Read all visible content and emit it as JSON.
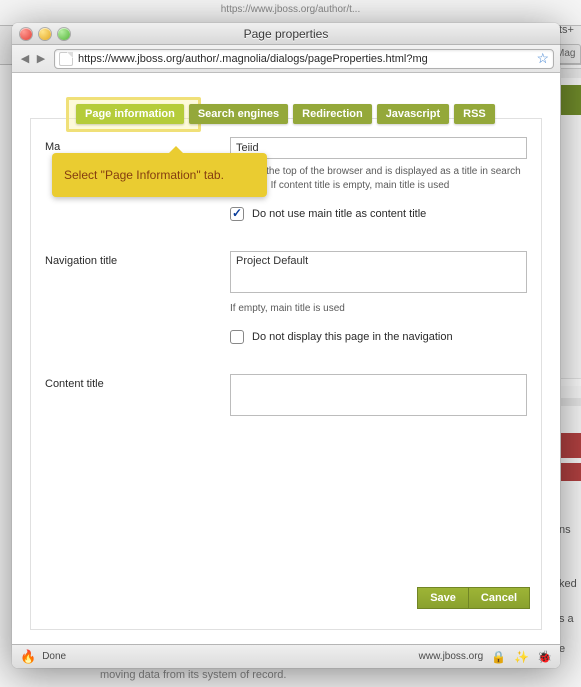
{
  "bg": {
    "top_url": "https://www.jboss.org/author/t...",
    "tab_label": "Mag",
    "bottom_text": "moving data from its system of record.",
    "side_ts": "ts+",
    "side_ns": "ns",
    "side_ked": "ked",
    "side_sa": "s a",
    "side_e": "e"
  },
  "window": {
    "title": "Page properties",
    "url": "https://www.jboss.org/author/.magnolia/dialogs/pageProperties.html?mg"
  },
  "tabs": {
    "page_information": "Page information",
    "search_engines": "Search engines",
    "redirection": "Redirection",
    "javascript": "Javascript",
    "rss": "RSS"
  },
  "callout": {
    "text": "Select \"Page Information\" tab."
  },
  "form": {
    "main_title_label": "Ma",
    "main_title_value": "Teiid",
    "main_title_hint_line": "...ars at the top of the browser and is displayed as a title in search engines. If content title is empty, main title is used",
    "no_content_title_label": "Do not use main title as content title",
    "nav_title_label": "Navigation title",
    "nav_title_value": "Project Default",
    "nav_title_hint": "If empty, main title is used",
    "no_nav_label": "Do not display this page in the navigation",
    "content_title_label": "Content title",
    "content_title_value": ""
  },
  "buttons": {
    "save": "Save",
    "cancel": "Cancel"
  },
  "statusbar": {
    "done": "Done",
    "domain": "www.jboss.org"
  }
}
